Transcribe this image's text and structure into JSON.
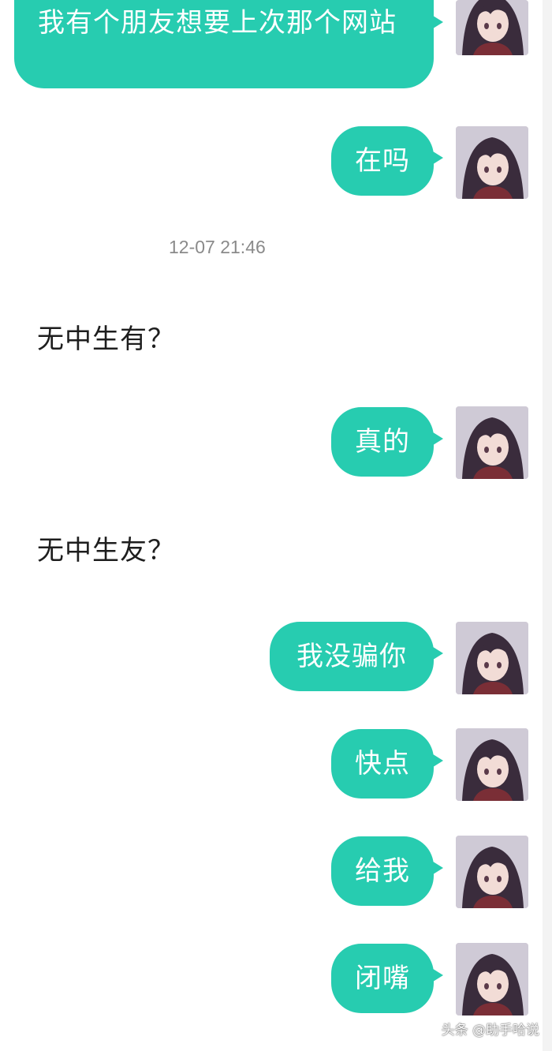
{
  "colors": {
    "bubble": "#27ccb0",
    "bubble_text": "#ffffff",
    "incoming_text": "#1e1e1e",
    "timestamp_text": "#8a8a8a"
  },
  "avatar_icon": "anime-girl-avatar-icon",
  "messages": [
    {
      "side": "outgoing",
      "text": "我有个朋友想要上次那个网站"
    },
    {
      "side": "outgoing",
      "text": "在吗"
    },
    {
      "side": "system",
      "text": "12-07 21:46"
    },
    {
      "side": "incoming",
      "text": "无中生有？"
    },
    {
      "side": "outgoing",
      "text": "真的"
    },
    {
      "side": "incoming",
      "text": "无中生友？"
    },
    {
      "side": "outgoing",
      "text": "我没骗你"
    },
    {
      "side": "outgoing",
      "text": "快点"
    },
    {
      "side": "outgoing",
      "text": "给我"
    },
    {
      "side": "outgoing",
      "text": "闭嘴"
    }
  ],
  "watermark": "头条 @助手哈说"
}
